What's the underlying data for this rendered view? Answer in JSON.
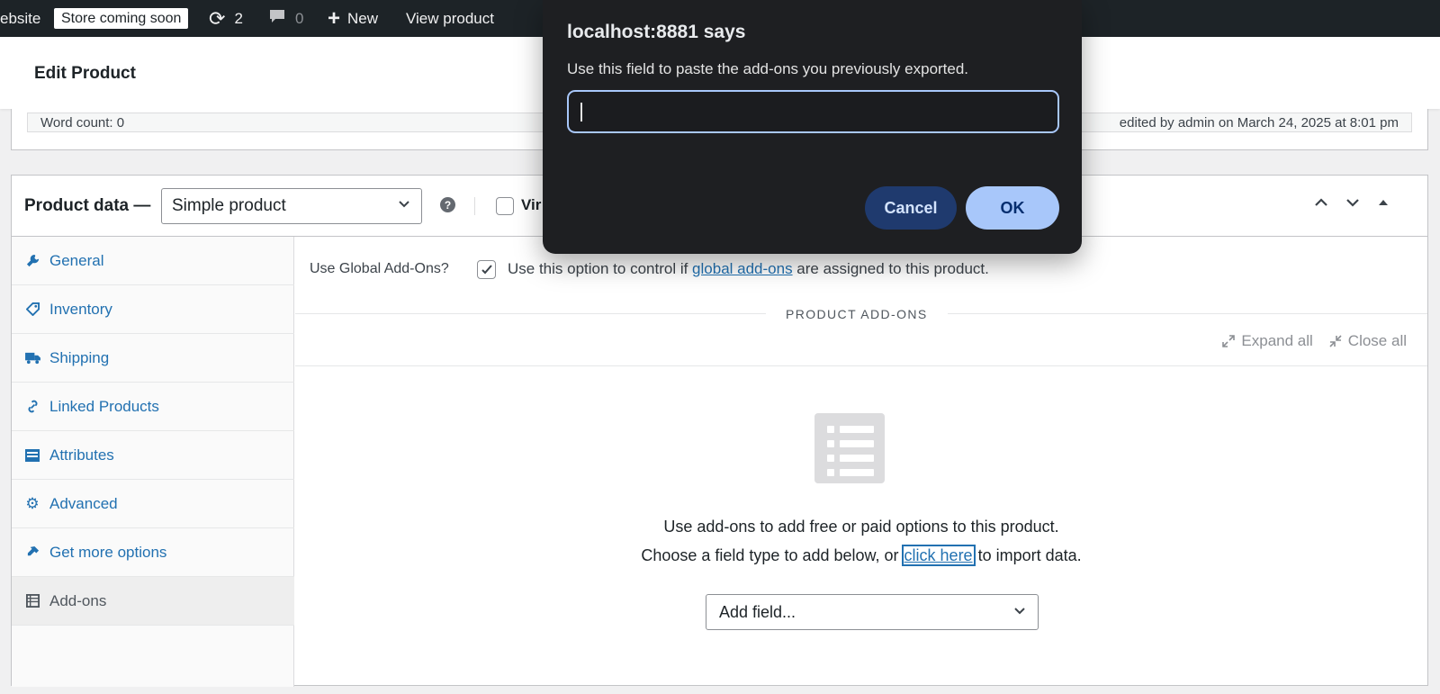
{
  "adminbar": {
    "site_label": "ebsite",
    "store_badge": "Store coming soon",
    "updates_count": "2",
    "comments_count": "0",
    "new_label": "New",
    "view_product_label": "View product"
  },
  "header": {
    "title": "Edit Product"
  },
  "editor_status": {
    "word_count": "Word count: 0",
    "last_edited": "edited by admin on March 24, 2025 at 8:01 pm"
  },
  "product_data": {
    "title": "Product data —",
    "type_selected": "Simple product",
    "virtual_label": "Vir",
    "tabs": [
      {
        "label": "General",
        "icon": "wrench-icon"
      },
      {
        "label": "Inventory",
        "icon": "tag-icon"
      },
      {
        "label": "Shipping",
        "icon": "truck-icon"
      },
      {
        "label": "Linked Products",
        "icon": "link-icon"
      },
      {
        "label": "Attributes",
        "icon": "list-icon"
      },
      {
        "label": "Advanced",
        "icon": "gear-icon"
      },
      {
        "label": "Get more options",
        "icon": "plugin-icon"
      },
      {
        "label": "Add-ons",
        "icon": "table-list-icon"
      }
    ],
    "active_tab": "Add-ons"
  },
  "addons": {
    "global_label": "Use Global Add-Ons?",
    "global_checked": true,
    "global_text_before": "Use this option to control if ",
    "global_link": "global add-ons",
    "global_text_after": " are assigned to this product.",
    "section_title": "PRODUCT ADD-ONS",
    "expand_all": "Expand all",
    "close_all": "Close all",
    "empty_line1": "Use add-ons to add free or paid options to this product.",
    "empty_line2_before": "Choose a field type to add below, or ",
    "empty_line2_link": "click here",
    "empty_line2_after": " to import data.",
    "add_field_selected": "Add field..."
  },
  "dialog": {
    "title": "localhost:8881 says",
    "message": "Use this field to paste the add-ons you previously exported.",
    "input_value": "",
    "cancel_label": "Cancel",
    "ok_label": "OK"
  },
  "colors": {
    "admin_bar": "#1d2327",
    "link": "#2271b1",
    "dialog_bg": "#1e1f22",
    "dialog_accent": "#a8c7fa"
  }
}
